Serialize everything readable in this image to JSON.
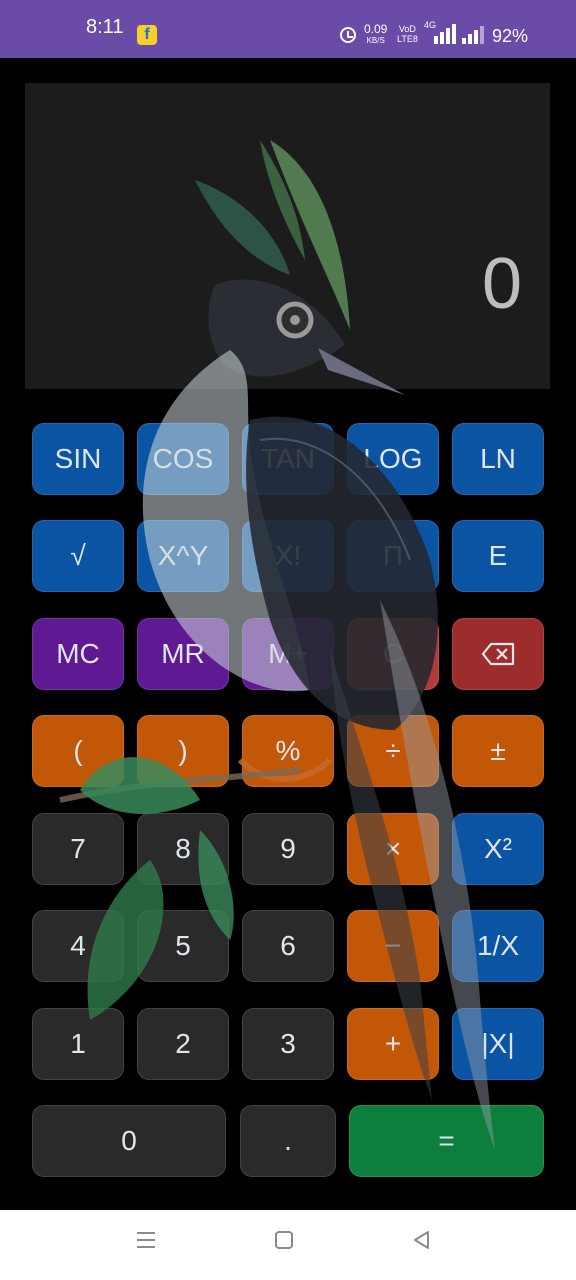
{
  "status_bar": {
    "time": "8:11",
    "notification_icon": "flipkart-icon",
    "alarm_icon": "alarm-icon",
    "speed_value": "0.09",
    "speed_unit": "KB/S",
    "volte_top": "VoD",
    "volte_bottom": "LTE8",
    "network": "4G",
    "battery": "92%",
    "background": "#6a4ba8"
  },
  "display": {
    "value": "0",
    "background": "#1c1c1c"
  },
  "keypad": {
    "row1": [
      "SIN",
      "COS",
      "TAN",
      "LOG",
      "LN"
    ],
    "row2": [
      "√",
      "X^Y",
      "X!",
      "Π",
      "E"
    ],
    "row3": [
      "MC",
      "MR",
      "M+",
      "C"
    ],
    "backspace_icon": "backspace-icon",
    "row4": [
      "(",
      ")",
      "%",
      "÷",
      "±"
    ],
    "row5": [
      "7",
      "8",
      "9",
      "×",
      "X²"
    ],
    "row6": [
      "4",
      "5",
      "6",
      "−",
      "1/X"
    ],
    "row7": [
      "1",
      "2",
      "3",
      "+",
      "|X|"
    ],
    "row8": [
      "0",
      ".",
      "="
    ]
  },
  "colors": {
    "scientific": "#0b53a3",
    "memory": "#5e1993",
    "clear": "#b33a3b",
    "operator": "#c25708",
    "number": "#2a2a2a",
    "equals": "#0d7f3c"
  },
  "nav_bar": {
    "recent": "menu-icon",
    "home": "home-icon",
    "back": "back-icon"
  }
}
